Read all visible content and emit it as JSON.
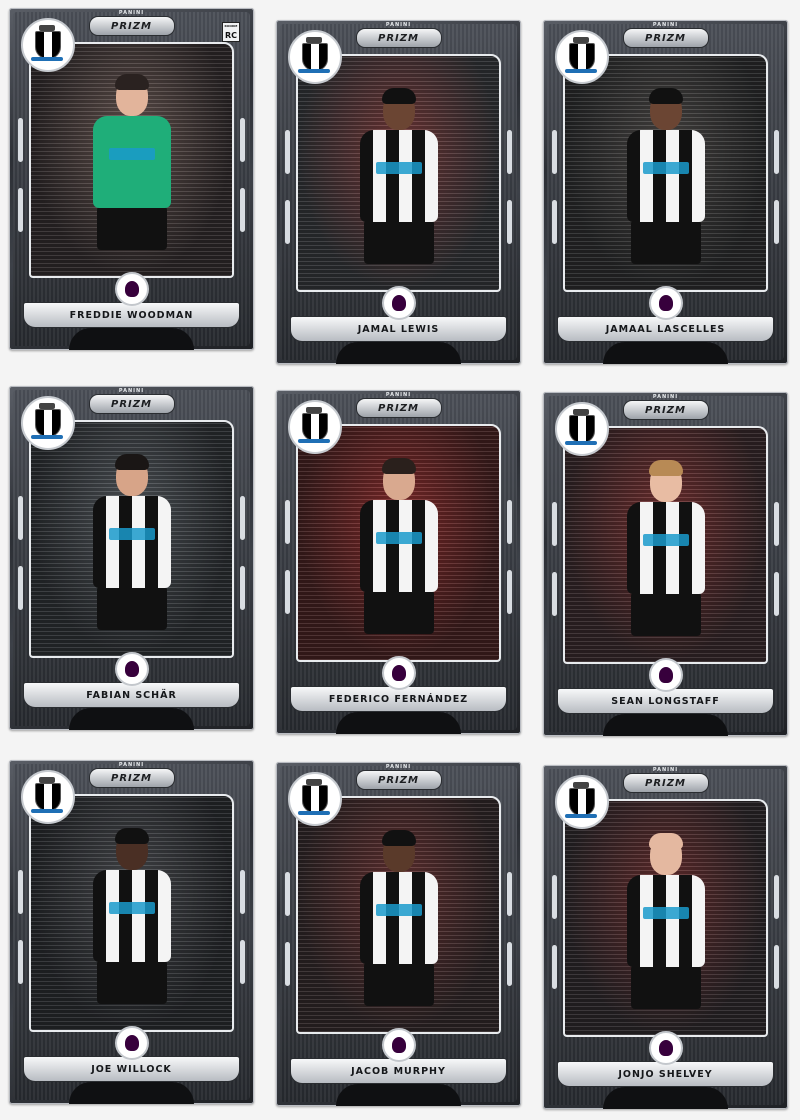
{
  "brand": {
    "manufacturer": "PANINI",
    "line": "PRIZM"
  },
  "cards": [
    {
      "name": "Freddie Woodman",
      "rookie": true,
      "rookie_label": "RC",
      "kit": "goalkeeper",
      "shirt_color": "#1fae79",
      "photo_bg": [
        "#6b5a55",
        "#2a2526"
      ]
    },
    {
      "name": "Jamal Lewis",
      "rookie": false,
      "kit": "home",
      "shirt_color": "stripes",
      "photo_bg": [
        "#7a3a3a",
        "#2b2d30"
      ]
    },
    {
      "name": "Jamaal Lascelles",
      "rookie": false,
      "kit": "home",
      "shirt_color": "stripes",
      "photo_bg": [
        "#4d4a48",
        "#242526"
      ]
    },
    {
      "name": "Fabian Schär",
      "rookie": false,
      "kit": "home",
      "shirt_color": "stripes",
      "photo_bg": [
        "#555a5f",
        "#26292c"
      ]
    },
    {
      "name": "Federico Fernández",
      "rookie": false,
      "kit": "home",
      "shirt_color": "stripes",
      "photo_bg": [
        "#8a2e2e",
        "#3a1c1c"
      ]
    },
    {
      "name": "Sean Longstaff",
      "rookie": false,
      "kit": "home",
      "shirt_color": "stripes",
      "photo_bg": [
        "#7a3232",
        "#2e2224"
      ]
    },
    {
      "name": "Joe Willock",
      "rookie": false,
      "kit": "home",
      "shirt_color": "stripes",
      "photo_bg": [
        "#4c4e52",
        "#222427"
      ]
    },
    {
      "name": "Jacob Murphy",
      "rookie": false,
      "kit": "home",
      "shirt_color": "stripes",
      "photo_bg": [
        "#6a3434",
        "#2a2223"
      ]
    },
    {
      "name": "Jonjo Shelvey",
      "rookie": false,
      "kit": "home",
      "shirt_color": "stripes",
      "photo_bg": [
        "#6d3030",
        "#262225"
      ]
    }
  ],
  "icons": {
    "club": "newcastle-crest-icon",
    "league": "premier-league-lion-icon"
  }
}
